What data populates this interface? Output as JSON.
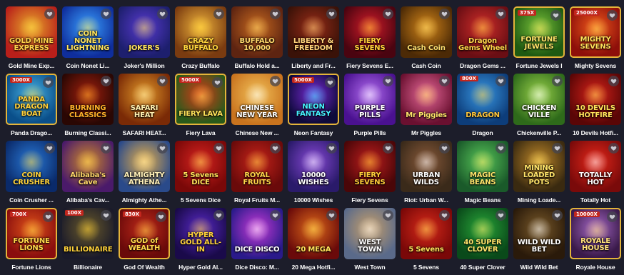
{
  "favorite_icon": "heart-icon",
  "games": [
    {
      "id": "gold-mine-express",
      "name": "Gold Mine Exp...",
      "art": "GOLD MINE EXPRESS",
      "bg": [
        "#b81f1a",
        "#e9a92b"
      ],
      "fg": "#ffd24a",
      "framed": false
    },
    {
      "id": "coin-nonet-lightning",
      "name": "Coin Nonet Li...",
      "art": "COIN NONET LIGHTNING",
      "bg": [
        "#0f2e9c",
        "#3aa0ff"
      ],
      "fg": "#ffe35a",
      "framed": false
    },
    {
      "id": "jokers-million",
      "name": "Joker's Million",
      "art": "JOKER'S",
      "bg": [
        "#1d1f6e",
        "#5a3bd1"
      ],
      "fg": "#ffe25c",
      "framed": false
    },
    {
      "id": "crazy-buffalo",
      "name": "Crazy Buffalo",
      "art": "CRAZY BUFFALO",
      "bg": [
        "#7a3b10",
        "#f0b43c"
      ],
      "fg": "#ffd53d",
      "framed": false
    },
    {
      "id": "buffalo-hold-and-win",
      "name": "Buffalo Hold a...",
      "art": "BUFFALO 10,000",
      "bg": [
        "#5e2411",
        "#c86a20"
      ],
      "fg": "#ffd86b",
      "framed": false
    },
    {
      "id": "liberty-and-freedom",
      "name": "Liberty and Fr...",
      "art": "LIBERTY & FREEDOM",
      "bg": [
        "#3a1208",
        "#9a2c18"
      ],
      "fg": "#ffd27a",
      "framed": false
    },
    {
      "id": "fiery-sevens-exclusive",
      "name": "Fiery Sevens E...",
      "art": "FIERY SEVENS",
      "bg": [
        "#4a0410",
        "#d21c2a"
      ],
      "fg": "#ffcf3a",
      "framed": false
    },
    {
      "id": "cash-coin",
      "name": "Cash Coin",
      "art": "Cash Coin",
      "bg": [
        "#4c2a06",
        "#d4861a"
      ],
      "fg": "#ffe070",
      "framed": false
    },
    {
      "id": "dragon-gems-wheel",
      "name": "Dragon Gems ...",
      "art": "Dragon Gems Wheel",
      "bg": [
        "#6a0e14",
        "#d12e2a"
      ],
      "fg": "#ffd54a",
      "framed": false
    },
    {
      "id": "fortune-jewels",
      "name": "Fortune Jewels I",
      "badge": "375X",
      "art": "FORTUNE JEWELS",
      "bg": [
        "#1f5a12",
        "#7ac23a"
      ],
      "fg": "#ffe468",
      "framed": true
    },
    {
      "id": "mighty-sevens",
      "name": "Mighty Sevens",
      "badge": "25000X",
      "art": "MIGHTY SEVENS",
      "bg": [
        "#8e0f0a",
        "#f05a1c"
      ],
      "fg": "#ffe15a",
      "framed": true
    },
    {
      "id": "panda-dragon-boat",
      "name": "Panda Drago...",
      "badge": "3000X",
      "art": "PANDA DRAGON BOAT",
      "bg": [
        "#0a4f8a",
        "#49b4e6"
      ],
      "fg": "#ffcf3a",
      "framed": true
    },
    {
      "id": "burning-classics",
      "name": "Burning Classi...",
      "art": "BURNING CLASSICS",
      "bg": [
        "#2a0703",
        "#a3200e"
      ],
      "fg": "#ffb12a",
      "framed": false
    },
    {
      "id": "safari-heat",
      "name": "SAFARI HEAT...",
      "art": "SAFARI HEAT",
      "bg": [
        "#7a2a06",
        "#e49a2a"
      ],
      "fg": "#fff0b0",
      "framed": false
    },
    {
      "id": "fiery-lava",
      "name": "Fiery Lava",
      "badge": "5000X",
      "art": "FIERY LAVA",
      "bg": [
        "#2a5a1a",
        "#d83a18"
      ],
      "fg": "#ffe25a",
      "framed": true
    },
    {
      "id": "chinese-new-year",
      "name": "Chinese New ...",
      "art": "CHINESE NEW YEAR",
      "bg": [
        "#c9731e",
        "#f2c25a"
      ],
      "fg": "#ffffff",
      "framed": false
    },
    {
      "id": "neon-fantasy",
      "name": "Neon Fantasy",
      "badge": "5000X",
      "art": "NEON FANTASY",
      "bg": [
        "#0e0a3a",
        "#7a2ad8"
      ],
      "fg": "#46f2ff",
      "framed": true
    },
    {
      "id": "purple-pills",
      "name": "Purple Pills",
      "art": "PURPLE PILLS",
      "bg": [
        "#4a1190",
        "#b36cf0"
      ],
      "fg": "#ffffff",
      "framed": false
    },
    {
      "id": "mr-piggies",
      "name": "Mr Piggles",
      "art": "Mr Piggies",
      "bg": [
        "#6a1030",
        "#e86a9a"
      ],
      "fg": "#ffe56a",
      "framed": false
    },
    {
      "id": "dragon",
      "name": "Dragon",
      "badge": "800X",
      "art": "DRAGON",
      "bg": [
        "#0d3d7a",
        "#3a9ae6"
      ],
      "fg": "#ffc63a",
      "framed": false
    },
    {
      "id": "chickenville-pop",
      "name": "Chickenville P...",
      "art": "CHICKEN VILLE",
      "bg": [
        "#2e6a1a",
        "#9ad24a"
      ],
      "fg": "#ffffff",
      "framed": false
    },
    {
      "id": "10-devils-hotfire",
      "name": "10 Devils Hotfi...",
      "art": "10 DEVILS HOTFIRE",
      "bg": [
        "#5a0606",
        "#d8221a"
      ],
      "fg": "#ffe25a",
      "framed": false
    },
    {
      "id": "coin-crusher",
      "name": "Coin Crusher ...",
      "art": "COIN CRUSHER",
      "bg": [
        "#0a2a6a",
        "#2a7ad8"
      ],
      "fg": "#ffd23a",
      "framed": false
    },
    {
      "id": "alibabas-cave",
      "name": "Alibaba's Cav...",
      "art": "Alibaba's Cave",
      "bg": [
        "#4a1a6a",
        "#d08a2a"
      ],
      "fg": "#ffd86a",
      "framed": false
    },
    {
      "id": "almighty-athena",
      "name": "Almighty Athe...",
      "art": "ALMIGHTY ATHENA",
      "bg": [
        "#2a4a8a",
        "#e6b04a"
      ],
      "fg": "#fff0b8",
      "framed": false
    },
    {
      "id": "5-sevens-dice",
      "name": "5 Sevens Dice",
      "art": "5 Sevens DICE",
      "bg": [
        "#7a0808",
        "#d82420"
      ],
      "fg": "#ffe45a",
      "framed": false
    },
    {
      "id": "royal-fruits-multilines",
      "name": "Royal Fruits M...",
      "art": "ROYAL FRUITS",
      "bg": [
        "#6a0a0a",
        "#c8241a"
      ],
      "fg": "#ffd64a",
      "framed": false
    },
    {
      "id": "10000-wishes",
      "name": "10000 Wishes",
      "art": "10000 WISHES",
      "bg": [
        "#2a1a6a",
        "#8a4ad8"
      ],
      "fg": "#ffffff",
      "framed": false
    },
    {
      "id": "fiery-sevens",
      "name": "Fiery Sevens",
      "art": "FIERY SEVENS",
      "bg": [
        "#4a0608",
        "#c01e1e"
      ],
      "fg": "#ffcf3a",
      "framed": false
    },
    {
      "id": "riot-urban-wilds",
      "name": "Riot: Urban W...",
      "art": "URBAN WILDS",
      "bg": [
        "#3a2a1a",
        "#8a5a3a"
      ],
      "fg": "#ffffff",
      "framed": false
    },
    {
      "id": "magic-beans",
      "name": "Magic Beans",
      "art": "MAGIC BEANS",
      "bg": [
        "#1a5a2a",
        "#5ac85a"
      ],
      "fg": "#ffe46a",
      "framed": false
    },
    {
      "id": "mining-loaded-pots",
      "name": "Mining Loade...",
      "art": "MINING LOADED POTS",
      "bg": [
        "#3a2a10",
        "#c28a2a"
      ],
      "fg": "#ffe46a",
      "framed": false
    },
    {
      "id": "totally-hot",
      "name": "Totally Hot",
      "art": "TOTALLY HOT",
      "bg": [
        "#7a0a0a",
        "#e8281a"
      ],
      "fg": "#ffffff",
      "framed": false
    },
    {
      "id": "fortune-lions",
      "name": "Fortune Lions",
      "badge": "700X",
      "art": "FORTUNE LIONS",
      "bg": [
        "#8a0e0e",
        "#e0541a"
      ],
      "fg": "#ffd84a",
      "framed": true
    },
    {
      "id": "billionaire",
      "name": "Billionaire",
      "badge": "100X",
      "art": "BILLIONAIRE",
      "bg": [
        "#1a1a2a",
        "#6a5a2a"
      ],
      "fg": "#ffd23a",
      "framed": false
    },
    {
      "id": "god-of-wealth",
      "name": "God Of Wealth",
      "badge": "830X",
      "art": "GOD of WEALTH",
      "bg": [
        "#6a0a0a",
        "#c02a1a"
      ],
      "fg": "#ffd64a",
      "framed": true
    },
    {
      "id": "hyper-gold-all-in",
      "name": "Hyper Gold Al...",
      "art": "HYPER GOLD ALL-IN",
      "bg": [
        "#1a0a4a",
        "#5a2ac8"
      ],
      "fg": "#ffd23a",
      "framed": false
    },
    {
      "id": "dice-disco",
      "name": "Dice Disco: M...",
      "art": "DICE DISCO",
      "bg": [
        "#2a1a8a",
        "#c83ad8"
      ],
      "fg": "#ffffff",
      "framed": false
    },
    {
      "id": "20-mega-hotfire",
      "name": "20 Mega Hotfi...",
      "art": "20 MEGA",
      "bg": [
        "#6a0a0a",
        "#e06a1a"
      ],
      "fg": "#ffe25a",
      "framed": false
    },
    {
      "id": "west-town",
      "name": "West Town",
      "art": "WEST TOWN",
      "bg": [
        "#5a6a8a",
        "#c8a06a"
      ],
      "fg": "#ffffff",
      "framed": false
    },
    {
      "id": "5-sevens",
      "name": "5 Sevens",
      "art": "5 Sevens",
      "bg": [
        "#7a0808",
        "#d82a1a"
      ],
      "fg": "#ffe45a",
      "framed": false
    },
    {
      "id": "40-super-clover",
      "name": "40 Super Clover",
      "art": "40 SUPER CLOVER",
      "bg": [
        "#0a4a1a",
        "#2aa83a"
      ],
      "fg": "#ffe46a",
      "framed": false
    },
    {
      "id": "wild-wild-bet",
      "name": "Wild Wild Bet",
      "art": "WILD WILD BET",
      "bg": [
        "#2a1a0a",
        "#7a5a2a"
      ],
      "fg": "#ffffff",
      "framed": false
    },
    {
      "id": "royale-house",
      "name": "Royale House",
      "badge": "10000X",
      "art": "ROYALE HOUSE",
      "bg": [
        "#3a1a4a",
        "#a86ac8"
      ],
      "fg": "#ffe07a",
      "framed": true
    }
  ]
}
